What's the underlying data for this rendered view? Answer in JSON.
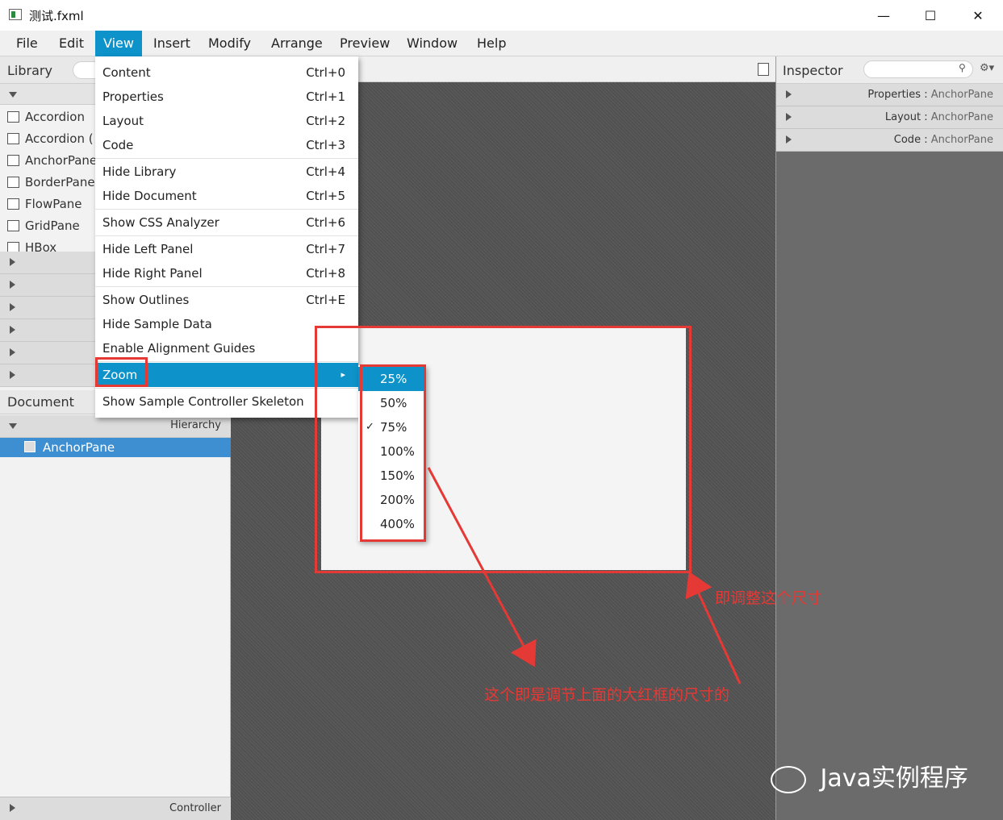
{
  "window": {
    "title": "测试.fxml",
    "minimize": "—",
    "maximize": "☐",
    "close": "✕"
  },
  "menubar": {
    "items": [
      "File",
      "Edit",
      "View",
      "Insert",
      "Modify",
      "Arrange",
      "Preview",
      "Window",
      "Help"
    ],
    "active": "View"
  },
  "library": {
    "title": "Library",
    "items": [
      "Accordion",
      "Accordion  (",
      "AnchorPane",
      "BorderPane",
      "FlowPane",
      "GridPane",
      "HBox"
    ]
  },
  "document": {
    "title": "Document",
    "hierarchy_label": "Hierarchy",
    "tree_item": "AnchorPane",
    "controller_label": "Controller"
  },
  "inspector": {
    "title": "Inspector",
    "sections": [
      {
        "label": "Properties",
        "sub": "AnchorPane"
      },
      {
        "label": "Layout",
        "sub": "AnchorPane"
      },
      {
        "label": "Code",
        "sub": "AnchorPane"
      }
    ]
  },
  "view_menu": {
    "items": [
      {
        "label": "Content",
        "accel": "Ctrl+0"
      },
      {
        "label": "Properties",
        "accel": "Ctrl+1"
      },
      {
        "label": "Layout",
        "accel": "Ctrl+2"
      },
      {
        "label": "Code",
        "accel": "Ctrl+3"
      },
      {
        "label": "Hide Library",
        "accel": "Ctrl+4"
      },
      {
        "label": "Hide Document",
        "accel": "Ctrl+5"
      },
      {
        "label": "Show CSS Analyzer",
        "accel": "Ctrl+6"
      },
      {
        "label": "Hide Left Panel",
        "accel": "Ctrl+7"
      },
      {
        "label": "Hide Right Panel",
        "accel": "Ctrl+8"
      },
      {
        "label": "Show Outlines",
        "accel": "Ctrl+E"
      },
      {
        "label": "Hide Sample Data",
        "accel": ""
      },
      {
        "label": "Enable Alignment Guides",
        "accel": ""
      },
      {
        "label": "Zoom",
        "accel": "▸"
      },
      {
        "label": "Show Sample Controller Skeleton",
        "accel": ""
      }
    ],
    "highlighted": "Zoom"
  },
  "zoom_submenu": {
    "options": [
      "25%",
      "50%",
      "75%",
      "100%",
      "150%",
      "200%",
      "400%"
    ],
    "highlighted": "25%",
    "checked": "75%"
  },
  "annotations": {
    "right_note": "即调整这个尺寸",
    "bottom_note": "这个即是调节上面的大红框的尺寸的"
  },
  "watermark": {
    "text": "Java实例程序"
  },
  "colors": {
    "accent": "#0d93c9",
    "annotation_red": "#e53935",
    "selection_blue": "#3d8fd1"
  }
}
